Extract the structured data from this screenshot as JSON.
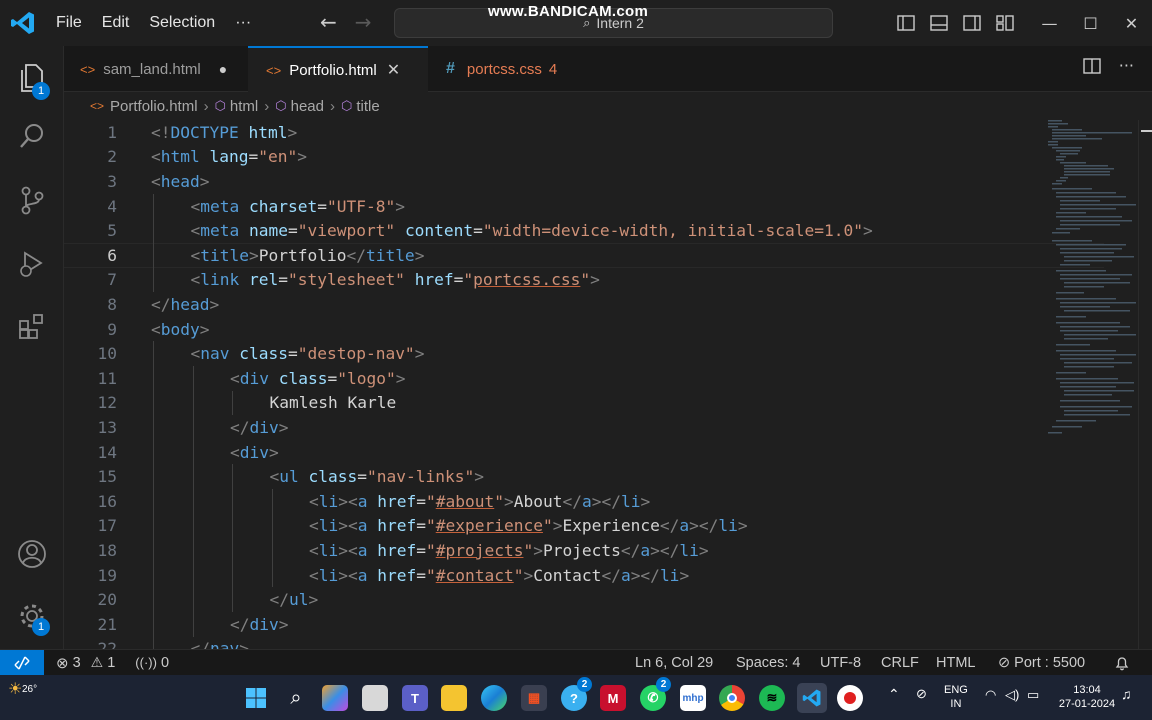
{
  "titlebar": {
    "menu": [
      "File",
      "Edit",
      "Selection",
      "···"
    ],
    "command_center": "Intern 2",
    "watermark": "www.BANDICAM.com"
  },
  "tabs": [
    {
      "label": "sam_land.html",
      "state": "modified-dot"
    },
    {
      "label": "Portfolio.html",
      "state": "active-close"
    },
    {
      "label": "portcss.css",
      "problems": "4"
    }
  ],
  "breadcrumb": [
    "Portfolio.html",
    "html",
    "head",
    "title"
  ],
  "activity_badges": {
    "explorer": "1",
    "settings": "1"
  },
  "editor": {
    "current_line": 6,
    "lines": [
      {
        "n": "1",
        "indent": 0,
        "tokens": [
          [
            "br",
            "<!"
          ],
          [
            "tag",
            "DOCTYPE"
          ],
          [
            "txt",
            " "
          ],
          [
            "attr",
            "html"
          ],
          [
            "br",
            ">"
          ]
        ]
      },
      {
        "n": "2",
        "indent": 0,
        "tokens": [
          [
            "br",
            "<"
          ],
          [
            "tag",
            "html"
          ],
          [
            "txt",
            " "
          ],
          [
            "attr",
            "lang"
          ],
          [
            "txt",
            "="
          ],
          [
            "str",
            "\"en\""
          ],
          [
            "br",
            ">"
          ]
        ]
      },
      {
        "n": "3",
        "indent": 0,
        "tokens": [
          [
            "br",
            "<"
          ],
          [
            "tag",
            "head"
          ],
          [
            "br",
            ">"
          ]
        ]
      },
      {
        "n": "4",
        "indent": 1,
        "tokens": [
          [
            "br",
            "<"
          ],
          [
            "tag",
            "meta"
          ],
          [
            "txt",
            " "
          ],
          [
            "attr",
            "charset"
          ],
          [
            "txt",
            "="
          ],
          [
            "str",
            "\"UTF-8\""
          ],
          [
            "br",
            ">"
          ]
        ]
      },
      {
        "n": "5",
        "indent": 1,
        "tokens": [
          [
            "br",
            "<"
          ],
          [
            "tag",
            "meta"
          ],
          [
            "txt",
            " "
          ],
          [
            "attr",
            "name"
          ],
          [
            "txt",
            "="
          ],
          [
            "str",
            "\"viewport\""
          ],
          [
            "txt",
            " "
          ],
          [
            "attr",
            "content"
          ],
          [
            "txt",
            "="
          ],
          [
            "str",
            "\"width=device-width, initial-scale=1.0\""
          ],
          [
            "br",
            ">"
          ]
        ]
      },
      {
        "n": "6",
        "indent": 1,
        "tokens": [
          [
            "br",
            "<"
          ],
          [
            "tag",
            "title"
          ],
          [
            "br",
            ">"
          ],
          [
            "txt",
            "Portfolio"
          ],
          [
            "br",
            "</"
          ],
          [
            "tag",
            "title"
          ],
          [
            "br",
            ">"
          ]
        ]
      },
      {
        "n": "7",
        "indent": 1,
        "tokens": [
          [
            "br",
            "<"
          ],
          [
            "tag",
            "link"
          ],
          [
            "txt",
            " "
          ],
          [
            "attr",
            "rel"
          ],
          [
            "txt",
            "="
          ],
          [
            "str",
            "\"stylesheet\""
          ],
          [
            "txt",
            " "
          ],
          [
            "attr",
            "href"
          ],
          [
            "txt",
            "="
          ],
          [
            "str",
            "\""
          ],
          [
            "strU",
            "portcss.css"
          ],
          [
            "str",
            "\""
          ],
          [
            "br",
            ">"
          ]
        ]
      },
      {
        "n": "8",
        "indent": 0,
        "tokens": [
          [
            "br",
            "</"
          ],
          [
            "tag",
            "head"
          ],
          [
            "br",
            ">"
          ]
        ]
      },
      {
        "n": "9",
        "indent": 0,
        "tokens": [
          [
            "br",
            "<"
          ],
          [
            "tag",
            "body"
          ],
          [
            "br",
            ">"
          ]
        ]
      },
      {
        "n": "10",
        "indent": 1,
        "tokens": [
          [
            "br",
            "<"
          ],
          [
            "tag",
            "nav"
          ],
          [
            "txt",
            " "
          ],
          [
            "attr",
            "class"
          ],
          [
            "txt",
            "="
          ],
          [
            "str",
            "\"destop-nav\""
          ],
          [
            "br",
            ">"
          ]
        ]
      },
      {
        "n": "11",
        "indent": 2,
        "tokens": [
          [
            "br",
            "<"
          ],
          [
            "tag",
            "div"
          ],
          [
            "txt",
            " "
          ],
          [
            "attr",
            "class"
          ],
          [
            "txt",
            "="
          ],
          [
            "str",
            "\"logo\""
          ],
          [
            "br",
            ">"
          ]
        ]
      },
      {
        "n": "12",
        "indent": 3,
        "tokens": [
          [
            "txt",
            "Kamlesh Karle"
          ]
        ]
      },
      {
        "n": "13",
        "indent": 2,
        "tokens": [
          [
            "br",
            "</"
          ],
          [
            "tag",
            "div"
          ],
          [
            "br",
            ">"
          ]
        ]
      },
      {
        "n": "14",
        "indent": 2,
        "tokens": [
          [
            "br",
            "<"
          ],
          [
            "tag",
            "div"
          ],
          [
            "br",
            ">"
          ]
        ]
      },
      {
        "n": "15",
        "indent": 3,
        "tokens": [
          [
            "br",
            "<"
          ],
          [
            "tag",
            "ul"
          ],
          [
            "txt",
            " "
          ],
          [
            "attr",
            "class"
          ],
          [
            "txt",
            "="
          ],
          [
            "str",
            "\"nav-links\""
          ],
          [
            "br",
            ">"
          ]
        ]
      },
      {
        "n": "16",
        "indent": 4,
        "tokens": [
          [
            "br",
            "<"
          ],
          [
            "tag",
            "li"
          ],
          [
            "br",
            "><"
          ],
          [
            "tag",
            "a"
          ],
          [
            "txt",
            " "
          ],
          [
            "attr",
            "href"
          ],
          [
            "txt",
            "="
          ],
          [
            "str",
            "\""
          ],
          [
            "strU",
            "#about"
          ],
          [
            "str",
            "\""
          ],
          [
            "br",
            ">"
          ],
          [
            "txt",
            "About"
          ],
          [
            "br",
            "</"
          ],
          [
            "tag",
            "a"
          ],
          [
            "br",
            "></"
          ],
          [
            "tag",
            "li"
          ],
          [
            "br",
            ">"
          ]
        ]
      },
      {
        "n": "17",
        "indent": 4,
        "tokens": [
          [
            "br",
            "<"
          ],
          [
            "tag",
            "li"
          ],
          [
            "br",
            "><"
          ],
          [
            "tag",
            "a"
          ],
          [
            "txt",
            " "
          ],
          [
            "attr",
            "href"
          ],
          [
            "txt",
            "="
          ],
          [
            "str",
            "\""
          ],
          [
            "strU",
            "#experience"
          ],
          [
            "str",
            "\""
          ],
          [
            "br",
            ">"
          ],
          [
            "txt",
            "Experience"
          ],
          [
            "br",
            "</"
          ],
          [
            "tag",
            "a"
          ],
          [
            "br",
            "></"
          ],
          [
            "tag",
            "li"
          ],
          [
            "br",
            ">"
          ]
        ]
      },
      {
        "n": "18",
        "indent": 4,
        "tokens": [
          [
            "br",
            "<"
          ],
          [
            "tag",
            "li"
          ],
          [
            "br",
            "><"
          ],
          [
            "tag",
            "a"
          ],
          [
            "txt",
            " "
          ],
          [
            "attr",
            "href"
          ],
          [
            "txt",
            "="
          ],
          [
            "str",
            "\""
          ],
          [
            "strU",
            "#projects"
          ],
          [
            "str",
            "\""
          ],
          [
            "br",
            ">"
          ],
          [
            "txt",
            "Projects"
          ],
          [
            "br",
            "</"
          ],
          [
            "tag",
            "a"
          ],
          [
            "br",
            "></"
          ],
          [
            "tag",
            "li"
          ],
          [
            "br",
            ">"
          ]
        ]
      },
      {
        "n": "19",
        "indent": 4,
        "tokens": [
          [
            "br",
            "<"
          ],
          [
            "tag",
            "li"
          ],
          [
            "br",
            "><"
          ],
          [
            "tag",
            "a"
          ],
          [
            "txt",
            " "
          ],
          [
            "attr",
            "href"
          ],
          [
            "txt",
            "="
          ],
          [
            "str",
            "\""
          ],
          [
            "strU",
            "#contact"
          ],
          [
            "str",
            "\""
          ],
          [
            "br",
            ">"
          ],
          [
            "txt",
            "Contact"
          ],
          [
            "br",
            "</"
          ],
          [
            "tag",
            "a"
          ],
          [
            "br",
            "></"
          ],
          [
            "tag",
            "li"
          ],
          [
            "br",
            ">"
          ]
        ]
      },
      {
        "n": "20",
        "indent": 3,
        "tokens": [
          [
            "br",
            "</"
          ],
          [
            "tag",
            "ul"
          ],
          [
            "br",
            ">"
          ]
        ]
      },
      {
        "n": "21",
        "indent": 2,
        "tokens": [
          [
            "br",
            "</"
          ],
          [
            "tag",
            "div"
          ],
          [
            "br",
            ">"
          ]
        ]
      },
      {
        "n": "22",
        "indent": 1,
        "tokens": [
          [
            "br",
            "</"
          ],
          [
            "tag",
            "nav"
          ],
          [
            "br",
            ">"
          ]
        ]
      }
    ]
  },
  "statusbar": {
    "errors": "3",
    "warnings": "1",
    "ports": "0",
    "position": "Ln 6, Col 29",
    "spaces": "Spaces: 4",
    "encoding": "UTF-8",
    "eol": "CRLF",
    "language": "HTML",
    "port": "Port : 5500"
  },
  "taskbar": {
    "weather": "26°",
    "teams_badge": "2",
    "whatsapp_badge": "2",
    "lang_top": "ENG",
    "lang_bottom": "IN",
    "time": "13:04",
    "date": "27-01-2024"
  }
}
